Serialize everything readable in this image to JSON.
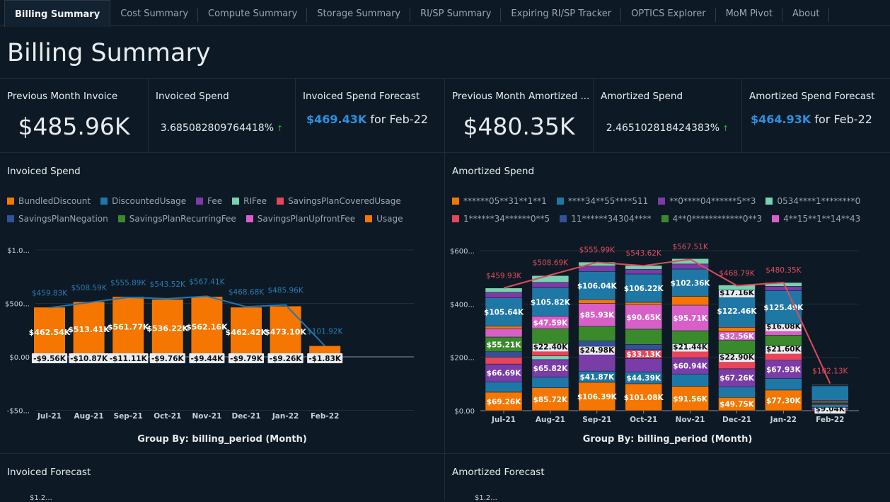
{
  "tabs": [
    "Billing Summary",
    "Cost Summary",
    "Compute Summary",
    "Storage Summary",
    "RI/SP Summary",
    "Expiring RI/SP Tracker",
    "OPTICS Explorer",
    "MoM Pivot",
    "About"
  ],
  "page_title": "Billing Summary",
  "kpis": {
    "prev_invoice": {
      "label": "Previous Month Invoice",
      "value": "$485.96K"
    },
    "invoiced_spend": {
      "label": "Invoiced Spend",
      "value": "3.685082809764418%",
      "trend": "up"
    },
    "invoiced_forecast": {
      "label": "Invoiced Spend Forecast",
      "value": "$469.43K",
      "suffix": "for Feb-22"
    },
    "prev_amortized": {
      "label": "Previous Month Amortized ...",
      "value": "$480.35K"
    },
    "amortized_spend": {
      "label": "Amortized Spend",
      "value": "2.465102818424383%",
      "trend": "up"
    },
    "amortized_forecast": {
      "label": "Amortized Spend Forecast",
      "value": "$464.93K",
      "suffix": "for Feb-22"
    }
  },
  "bottom": {
    "left_title": "Invoiced Forecast",
    "right_title": "Amortized Forecast",
    "tick": "$1.2..."
  },
  "chart_data": [
    {
      "type": "bar",
      "title": "Invoiced Spend",
      "xlabel": "Group By: billing_period (Month)",
      "categories": [
        "Jul-21",
        "Aug-21",
        "Sep-21",
        "Oct-21",
        "Nov-21",
        "Dec-21",
        "Jan-22",
        "Feb-22"
      ],
      "yticks": [
        "$1.0...",
        "$500...",
        "$0.00",
        "-$50..."
      ],
      "ylim": [
        -500,
        1000
      ],
      "legend": [
        {
          "name": "BundledDiscount",
          "color": "#f57600"
        },
        {
          "name": "DiscountedUsage",
          "color": "#1f77a6"
        },
        {
          "name": "Fee",
          "color": "#7a3ca6"
        },
        {
          "name": "RIFee",
          "color": "#78d1b0"
        },
        {
          "name": "SavingsPlanCoveredUsage",
          "color": "#e8455a"
        },
        {
          "name": "SavingsPlanNegation",
          "color": "#34509b"
        },
        {
          "name": "SavingsPlanRecurringFee",
          "color": "#3a8a2c"
        },
        {
          "name": "SavingsPlanUpfrontFee",
          "color": "#d95fc8"
        },
        {
          "name": "Usage",
          "color": "#f57600"
        }
      ],
      "usage": [
        462.54,
        513.41,
        561.77,
        536.22,
        562.16,
        462.42,
        473.1,
        101.92
      ],
      "usage_labels": [
        "$462.54K",
        "$513.41K",
        "$561.77K",
        "$536.22K",
        "$562.16K",
        "$462.42K",
        "$473.10K",
        ""
      ],
      "discount": [
        -9.56,
        -10.87,
        -11.11,
        -9.76,
        -9.44,
        -9.79,
        -9.26,
        -1.83
      ],
      "discount_labels": [
        "-$9.56K",
        "-$10.87K",
        "-$11.11K",
        "-$9.76K",
        "-$9.44K",
        "-$9.79K",
        "-$9.26K",
        "-$1.83K"
      ],
      "total": [
        459.83,
        508.59,
        555.89,
        543.52,
        567.41,
        468.68,
        485.96,
        101.92
      ],
      "total_labels": [
        "$459.83K",
        "$508.59K",
        "$555.89K",
        "$543.52K",
        "$567.41K",
        "$468.68K",
        "$485.96K",
        "$101.92K"
      ],
      "line_color": "#1f77b4"
    },
    {
      "type": "bar",
      "title": "Amortized Spend",
      "xlabel": "Group By: billing_period (Month)",
      "categories": [
        "Jul-21",
        "Aug-21",
        "Sep-21",
        "Oct-21",
        "Nov-21",
        "Dec-21",
        "Jan-22",
        "Feb-22"
      ],
      "yticks": [
        "$600...",
        "$400...",
        "$200...",
        "$0.00"
      ],
      "ylim": [
        0,
        600
      ],
      "legend": [
        {
          "name": "******05**31**1**1",
          "color": "#f57600"
        },
        {
          "name": "****34**55****511",
          "color": "#1f77a6"
        },
        {
          "name": "**0****04******5**3",
          "color": "#7a3ca6"
        },
        {
          "name": "0534****1********0",
          "color": "#78d1b0"
        },
        {
          "name": "1******34******0**5",
          "color": "#e8455a"
        },
        {
          "name": "11******34304****",
          "color": "#34509b"
        },
        {
          "name": "4**0************0**3",
          "color": "#3a8a2c"
        },
        {
          "name": "4**15**1**14**43",
          "color": "#d95fc8"
        }
      ],
      "stacks": [
        [
          [
            0,
            69.26,
            "in"
          ],
          [
            1,
            39
          ],
          [
            2,
            66.69,
            "in"
          ],
          [
            4,
            26
          ],
          [
            5,
            20
          ],
          [
            6,
            55.21,
            "in"
          ],
          [
            7,
            31
          ],
          [
            0,
            10
          ],
          [
            1,
            105.64,
            "in"
          ],
          [
            2,
            21
          ],
          [
            3,
            16
          ]
        ],
        [
          [
            0,
            85.72,
            "in"
          ],
          [
            1,
            40
          ],
          [
            2,
            65.82,
            "in"
          ],
          [
            3,
            14
          ],
          [
            4,
            24
          ],
          [
            5,
            22.4,
            "box"
          ],
          [
            6,
            55
          ],
          [
            7,
            47.59,
            "in"
          ],
          [
            1,
            105.82,
            "in"
          ],
          [
            2,
            21
          ],
          [
            3,
            25
          ]
        ],
        [
          [
            0,
            106.39,
            "in"
          ],
          [
            1,
            41.87,
            "in"
          ],
          [
            2,
            68
          ],
          [
            4,
            24.98,
            "box"
          ],
          [
            5,
            20
          ],
          [
            6,
            55
          ],
          [
            7,
            85.93,
            "in"
          ],
          [
            0,
            14
          ],
          [
            1,
            106.04,
            "in"
          ],
          [
            2,
            20
          ],
          [
            3,
            15
          ]
        ],
        [
          [
            0,
            101.08,
            "in"
          ],
          [
            1,
            44.39,
            "in"
          ],
          [
            2,
            50
          ],
          [
            4,
            33.13,
            "in"
          ],
          [
            5,
            20
          ],
          [
            6,
            57
          ],
          [
            7,
            90.65,
            "in"
          ],
          [
            0,
            10
          ],
          [
            1,
            106.22,
            "in"
          ],
          [
            2,
            18
          ],
          [
            3,
            14
          ]
        ],
        [
          [
            0,
            91.56,
            "in"
          ],
          [
            1,
            46
          ],
          [
            2,
            60.94,
            "in"
          ],
          [
            4,
            31
          ],
          [
            5,
            21.44,
            "box"
          ],
          [
            6,
            49
          ],
          [
            7,
            95.71,
            "in"
          ],
          [
            0,
            33
          ],
          [
            1,
            102.36,
            "in"
          ],
          [
            2,
            19
          ],
          [
            3,
            20
          ]
        ],
        [
          [
            0,
            49.75,
            "in"
          ],
          [
            1,
            40
          ],
          [
            2,
            67.26,
            "in"
          ],
          [
            4,
            33
          ],
          [
            5,
            22.9,
            "box"
          ],
          [
            6,
            51
          ],
          [
            7,
            32.56,
            "in"
          ],
          [
            0,
            16
          ],
          [
            1,
            122.46,
            "in"
          ],
          [
            2,
            17.16,
            "box"
          ],
          [
            3,
            19
          ]
        ],
        [
          [
            0,
            77.3,
            "in"
          ],
          [
            1,
            44
          ],
          [
            2,
            67.93,
            "in"
          ],
          [
            4,
            32
          ],
          [
            5,
            21.6,
            "box"
          ],
          [
            6,
            40
          ],
          [
            7,
            26
          ],
          [
            0,
            16.08,
            "box"
          ],
          [
            1,
            125.49,
            "in"
          ],
          [
            2,
            16
          ],
          [
            3,
            14
          ]
        ],
        [
          [
            0,
            3
          ],
          [
            2,
            9.04,
            "box"
          ],
          [
            1,
            10
          ],
          [
            4,
            3
          ],
          [
            5,
            3
          ],
          [
            6,
            4
          ],
          [
            7,
            3
          ],
          [
            0,
            3
          ],
          [
            1,
            55
          ],
          [
            2,
            2
          ],
          [
            3,
            2
          ]
        ]
      ],
      "total": [
        459.93,
        508.69,
        555.99,
        543.62,
        567.51,
        468.79,
        480.35,
        102.13
      ],
      "total_labels": [
        "$459.93K",
        "$508.69K",
        "$555.99K",
        "$543.62K",
        "$567.51K",
        "$468.79K",
        "$480.35K",
        "$102.13K"
      ],
      "line_color": "#e04a5c"
    }
  ]
}
